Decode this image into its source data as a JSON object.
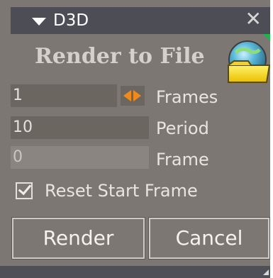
{
  "window": {
    "title": "D3D",
    "close_glyph": "✕",
    "collapse_icon": "triangle-down-icon",
    "accent_color": "#22b24c"
  },
  "panel": {
    "heading": "Render to File",
    "folder_icon": "folder-icon"
  },
  "fields": {
    "frames": {
      "value": "1",
      "label": "Frames",
      "stepper_icon": "left-right-arrows-icon",
      "stepper_color": "#f28a1a"
    },
    "period": {
      "value": "10",
      "label": "Period"
    },
    "frame": {
      "value": "0",
      "label": "Frame"
    }
  },
  "options": {
    "reset_start_frame": {
      "label": "Reset Start Frame",
      "checked": true
    }
  },
  "buttons": {
    "render": "Render",
    "cancel": "Cancel"
  }
}
